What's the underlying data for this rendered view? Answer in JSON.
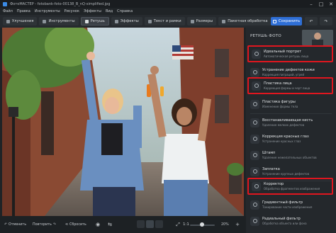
{
  "window": {
    "title": "ФотоМАСТЕР - fotobank-foto-00138_B_nQ-simplified.jpg",
    "minimize": "–",
    "maximize": "□",
    "close": "✕"
  },
  "menu": [
    "Файл",
    "Правка",
    "Инструменты",
    "Рисунок",
    "Эффекты",
    "Вид",
    "Справка"
  ],
  "toolbar": {
    "tabs": [
      {
        "label": "Улучшения",
        "icon": "enhance-icon"
      },
      {
        "label": "Инструменты",
        "icon": "tools-icon"
      },
      {
        "label": "Ретушь",
        "icon": "retouch-icon",
        "active": true
      },
      {
        "label": "Эффекты",
        "icon": "effects-icon"
      },
      {
        "label": "Текст и рамки",
        "icon": "text-icon"
      },
      {
        "label": "Размеры",
        "icon": "resize-icon"
      },
      {
        "label": "Пакетная обработка",
        "icon": "batch-icon"
      }
    ],
    "save_label": "Сохранить",
    "undo": "↶",
    "redo": "↷"
  },
  "panel": {
    "title": "РЕТУШЬ ФОТО",
    "items": [
      {
        "name": "Идеальный портрет",
        "desc": "Автоматическая ретушь лица",
        "highlighted": true
      },
      {
        "name": "Устранение дефектов кожи",
        "desc": "Коррекция пиграций, угрей",
        "highlighted": false
      },
      {
        "name": "Пластика лица",
        "desc": "Коррекция формы и черт лица",
        "highlighted": true
      },
      {
        "name": "Пластика фигуры",
        "desc": "Изменение формы тела",
        "highlighted": false
      },
      {
        "name": "Восстанавливающая кисть",
        "desc": "Удаление мелких дефектов",
        "highlighted": false
      },
      {
        "name": "Коррекция красных глаз",
        "desc": "Устранение красных глаз",
        "highlighted": false
      },
      {
        "name": "Штамп",
        "desc": "Удаление нежелательных объектов",
        "highlighted": false
      },
      {
        "name": "Заплатка",
        "desc": "Устранение крупных дефектов",
        "highlighted": false
      },
      {
        "name": "Корректор",
        "desc": "Обработка фрагментов изображения",
        "highlighted": true
      },
      {
        "name": "Градиентный фильтр",
        "desc": "Тонирование части изображения",
        "highlighted": false
      },
      {
        "name": "Радиальный фильтр",
        "desc": "Обработка объекта или фона",
        "highlighted": false
      }
    ]
  },
  "bottom": {
    "cancel_label": "Отменить",
    "redo_label": "Повторить",
    "reset_label": "Сбросить",
    "eye": "◉",
    "split": "⇆",
    "zoom_ratio": "1:1",
    "zoom_value": "20%",
    "zoom_minus": "−",
    "zoom_plus": "+",
    "fit": "⤢"
  }
}
